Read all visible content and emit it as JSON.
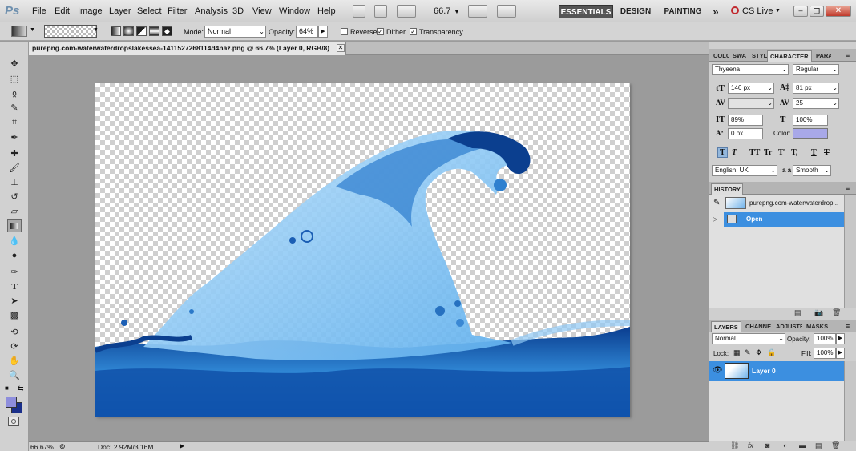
{
  "app": {
    "logo": "Ps"
  },
  "menu": [
    "File",
    "Edit",
    "Image",
    "Layer",
    "Select",
    "Filter",
    "Analysis",
    "3D",
    "View",
    "Window",
    "Help"
  ],
  "app_bar": {
    "zoom": "66.7",
    "workspaces": {
      "essentials": "ESSENTIALS",
      "design": "DESIGN",
      "painting": "PAINTING",
      "more": "»"
    },
    "cs_live": "CS Live"
  },
  "options": {
    "mode_label": "Mode:",
    "mode_value": "Normal",
    "opacity_label": "Opacity:",
    "opacity_value": "64%",
    "reverse": "Reverse",
    "dither": "Dither",
    "transparency": "Transparency"
  },
  "document": {
    "tab_title": "purepng.com-waterwaterdropslakessea-1411527268114d4naz.png @ 66.7% (Layer 0, RGB/8)"
  },
  "status": {
    "zoom": "66.67%",
    "doc": "Doc: 2.92M/3.16M"
  },
  "character_panel": {
    "tabs": [
      "COLO",
      "SWA",
      "STYL",
      "CHARACTER",
      "PARA"
    ],
    "font_family": "Thyeena",
    "font_style": "Regular",
    "size": "146 px",
    "leading": "81 px",
    "kerning": "",
    "tracking": "25",
    "vscale": "89%",
    "hscale": "100%",
    "baseline": "0 px",
    "color_label": "Color:",
    "language": "English: UK",
    "antialias_prefix": "a a",
    "antialias": "Smooth",
    "format_buttons": [
      "T",
      "T",
      "TT",
      "Tr",
      "T'",
      "T,",
      "T",
      "T"
    ]
  },
  "history_panel": {
    "title": "HISTORY",
    "snapshot": "purepng.com-waterwaterdrop...",
    "open": "Open"
  },
  "layers_panel": {
    "tabs": [
      "LAYERS",
      "CHANNE",
      "ADJUSTE",
      "MASKS"
    ],
    "blend": "Normal",
    "opacity_label": "Opacity:",
    "opacity": "100%",
    "lock_label": "Lock:",
    "fill_label": "Fill:",
    "fill": "100%",
    "layer_name": "Layer 0"
  },
  "colors": {
    "accent": "#3c8fe0",
    "swatch_fg": "#8e8edc",
    "char_color": "#a8a8e8"
  }
}
